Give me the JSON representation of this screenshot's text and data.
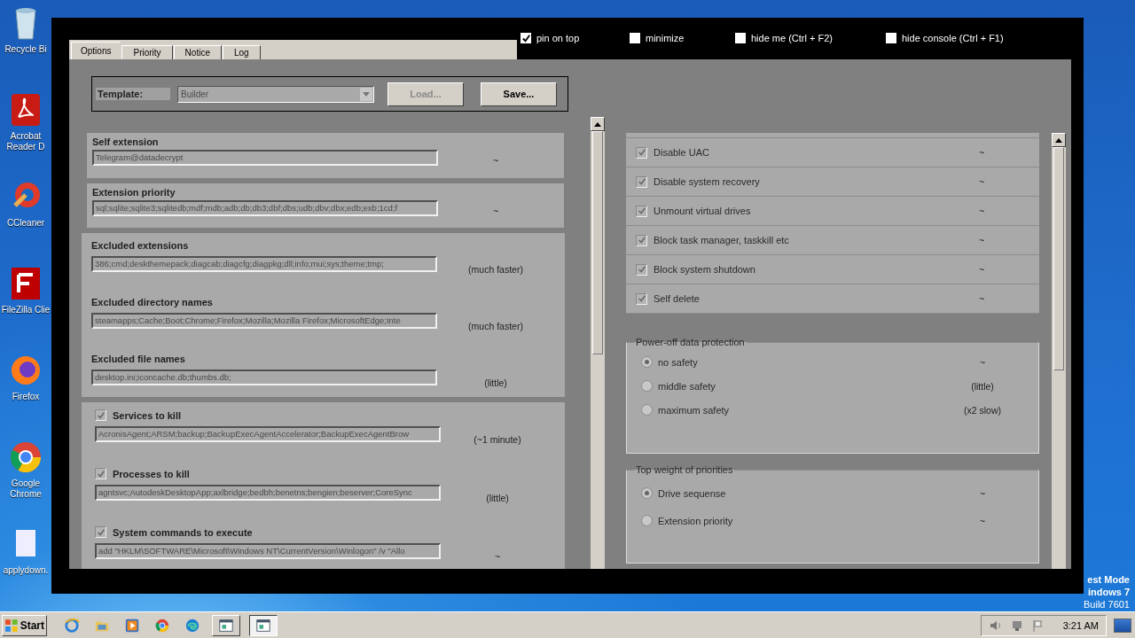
{
  "desktop": {
    "icons": [
      {
        "kind": "trash",
        "label": "Recycle Bi"
      },
      {
        "kind": "pdf",
        "label": "Acrobat\nReader D"
      },
      {
        "kind": "cleaner",
        "label": "CCleaner"
      },
      {
        "kind": "filezilla",
        "label": "FileZilla Clie"
      },
      {
        "kind": "firefox",
        "label": "Firefox"
      },
      {
        "kind": "chrome",
        "label": "Google\nChrome"
      },
      {
        "kind": "file",
        "label": "applydown."
      }
    ],
    "os_notice": [
      "est Mode",
      "indows 7",
      "Build 7601"
    ]
  },
  "window": {
    "tabs": [
      {
        "label": "Options",
        "selected": true
      },
      {
        "label": "Priority",
        "selected": false
      },
      {
        "label": "Notice",
        "selected": false
      },
      {
        "label": "Log",
        "selected": false
      }
    ],
    "toggles": [
      {
        "label": "pin on top",
        "checked": true
      },
      {
        "label": "minimize",
        "checked": false
      },
      {
        "label": "hide me (Ctrl + F2)",
        "checked": false
      },
      {
        "label": "hide console (Ctrl + F1)",
        "checked": false
      }
    ],
    "template": {
      "label": "Template:",
      "value": "Builder",
      "buttons": [
        {
          "label": "Load...",
          "disabled": true
        },
        {
          "label": "Save...",
          "disabled": false
        }
      ]
    },
    "sections": [
      {
        "fields": [
          {
            "label": "Self extension",
            "value": "Telegram@datadecrypt",
            "note": "~"
          }
        ]
      },
      {
        "fields": [
          {
            "label": "Extension priority",
            "value": "sql;sqlite;sqlite3;sqlitedb;mdf;mdb;adb;db;db3;dbf;dbs;udb;dbv;dbx;edb;exb;1cd;f",
            "note": "~"
          }
        ]
      },
      {
        "fields": [
          {
            "label": "Excluded extensions",
            "value": "386;cmd;deskthemepack;diagcab;diagcfg;diagpkg;dll;info;mui;sys;theme;tmp;",
            "note": "(much faster)"
          },
          {
            "label": "Excluded directory names",
            "value": "steamapps;Cache;Boot;Chrome;Firefox;Mozilla;Mozilla Firefox;MicrosoftEdge;Inte",
            "note": "(much faster)"
          },
          {
            "label": "Excluded file names",
            "value": "desktop.ini;iconcache.db;thumbs.db;",
            "note": "(little)"
          }
        ]
      },
      {
        "fields": [
          {
            "label": "Services to kill",
            "checked": true,
            "value": "AcronisAgent;ARSM;backup;BackupExecAgentAccelerator;BackupExecAgentBrow",
            "note": "(~1 minute)"
          },
          {
            "label": "Processes to kill",
            "checked": true,
            "value": "agntsvc;AutodeskDesktopApp;axlbridge;bedbh;benetns;bengien;beserver;CoreSync",
            "note": "(little)"
          },
          {
            "label": "System commands to execute",
            "checked": true,
            "value": "add \"HKLM\\SOFTWARE\\Microsoft\\Windows NT\\CurrentVersion\\Winlogon\" /v \"Allo",
            "note": "~"
          }
        ]
      }
    ],
    "options": [
      {
        "label": "Disable UAC",
        "checked": true,
        "note": "~"
      },
      {
        "label": "Disable system recovery",
        "checked": true,
        "note": "~"
      },
      {
        "label": "Unmount virtual drives",
        "checked": true,
        "note": "~"
      },
      {
        "label": "Block task manager, taskkill etc",
        "checked": true,
        "note": "~"
      },
      {
        "label": "Block system shutdown",
        "checked": true,
        "note": "~"
      },
      {
        "label": "Self delete",
        "checked": true,
        "note": "~"
      }
    ],
    "groups": [
      {
        "title": "Power-off data protection",
        "choices": [
          {
            "label": "no safety",
            "selected": true,
            "note": "~"
          },
          {
            "label": "middle safety",
            "selected": false,
            "note": "(little)"
          },
          {
            "label": "maximum safety",
            "selected": false,
            "note": "(x2 slow)"
          }
        ]
      },
      {
        "title": "Top weight of priorities",
        "choices": [
          {
            "label": "Drive sequense",
            "selected": true,
            "note": "~"
          },
          {
            "label": "Extension priority",
            "selected": false,
            "note": "~"
          }
        ]
      }
    ]
  },
  "taskbar": {
    "start": "Start",
    "apps": [
      {
        "kind": "ie",
        "running": false,
        "active": false
      },
      {
        "kind": "folder",
        "running": false,
        "active": false
      },
      {
        "kind": "media",
        "running": false,
        "active": false
      },
      {
        "kind": "chrome",
        "running": false,
        "active": false
      },
      {
        "kind": "edge",
        "running": false,
        "active": false
      },
      {
        "kind": "window",
        "running": true,
        "active": false
      },
      {
        "kind": "window",
        "running": true,
        "active": true
      }
    ],
    "clock": "3:21 AM"
  }
}
